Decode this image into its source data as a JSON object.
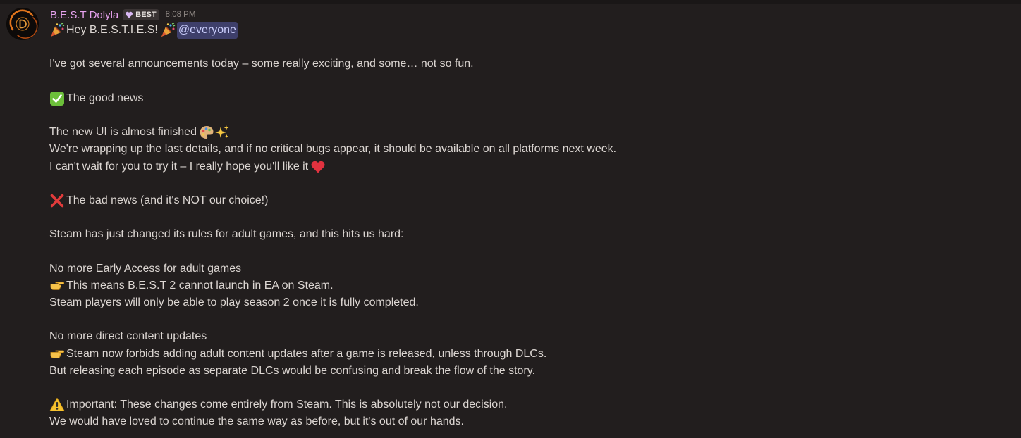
{
  "message": {
    "author": "B.E.S.T Dolyla",
    "tag": "BEST",
    "tag_icon": "purple-heart-icon",
    "timestamp": "8:08 PM",
    "avatar": "avatar-logo",
    "mention": "@everyone",
    "accent_colors": {
      "username": "#e6a2ee",
      "mention_bg": "#3e3f6a",
      "mention_text": "#c9cdfb",
      "background": "#221e1e"
    },
    "lines": {
      "greeting": "Hey B.E.S.T.I.E.S!",
      "intro": "I've got several announcements today – some really exciting, and some… not so fun.",
      "good_news_heading": "The good news",
      "ui_title": "The new UI is almost finished",
      "ui_detail": "We're wrapping up the last details, and if no critical bugs appear, it should be available on all platforms next week.",
      "ui_wait": "I can't wait for you to try it – I really hope you'll like it",
      "bad_news_heading": "The bad news (and it's NOT our choice!)",
      "steam_rules": "Steam has just changed its rules for adult games, and this hits us hard:",
      "no_ea": "No more Early Access for adult games",
      "no_ea_point": "This means B.E.S.T 2 cannot launch in EA on Steam.",
      "no_ea_detail": "Steam players will only be able to play season 2 once it is fully completed.",
      "no_updates": "No more direct content updates",
      "no_updates_point": "Steam now forbids adding adult content updates after a game is released, unless through DLCs.",
      "no_updates_detail": "But releasing each episode as separate DLCs would be confusing and break the flow of the story.",
      "important": "Important: These changes come entirely from Steam. This is absolutely not our decision.",
      "closing": "We would have loved to continue the same way as before, but it's out of our hands."
    },
    "emojis": {
      "greeting": "party-popper-icon",
      "good_news": "check-mark-button-icon",
      "ui": [
        "artist-palette-icon",
        "sparkles-icon"
      ],
      "heart": "red-heart-icon",
      "bad_news": "cross-mark-icon",
      "pointer": "backhand-index-pointing-right-icon",
      "warning": "warning-icon"
    }
  }
}
